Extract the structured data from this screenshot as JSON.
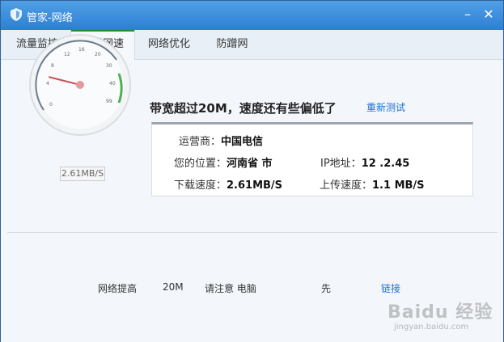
{
  "window": {
    "title": "管家-网络",
    "minimize_glyph": "–",
    "close_glyph": "✕",
    "accent_color": "#2e7fd3"
  },
  "tabs": [
    {
      "label": "流量监控",
      "active": false
    },
    {
      "label": "测试网速",
      "active": true
    },
    {
      "label": "网络优化",
      "active": false
    },
    {
      "label": "防蹭网",
      "active": false
    }
  ],
  "gauge": {
    "scale_labels": [
      "0",
      "4",
      "8",
      "12",
      "16",
      "20",
      "30",
      "40",
      "99"
    ],
    "readout": "2.61MB/S",
    "needle_level": 0.22
  },
  "result": {
    "headline": "带宽超过20M，速度还有些偏低了",
    "retest_label": "重新测试"
  },
  "info": {
    "isp": {
      "label": "运营商：",
      "value": "中国电信"
    },
    "location": {
      "label": "您的位置：",
      "value": "河南省  市"
    },
    "ip": {
      "label": "IP地址：",
      "value": "12  .2.45"
    },
    "download": {
      "label": "下载速度：",
      "value": "2.61MB/S"
    },
    "upload": {
      "label": "上传速度：",
      "value": "1.1 MB/S"
    }
  },
  "footer": {
    "item1": "网络提高",
    "item2": "20M",
    "item3": "请注意  电脑",
    "item4": "先",
    "link": "链接"
  },
  "watermark": {
    "logo": "Baidu 经验",
    "url": "jingyan.baidu.com"
  }
}
